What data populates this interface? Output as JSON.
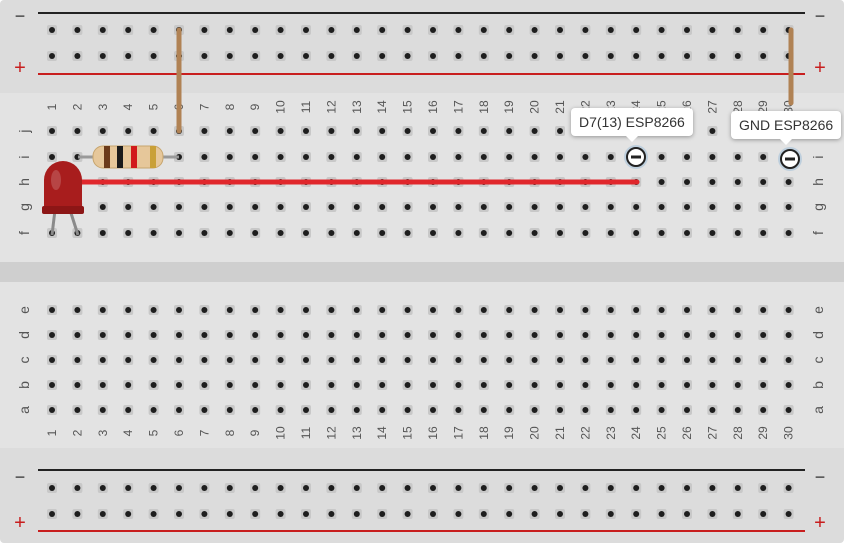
{
  "breadboard": {
    "column_numbers": [
      "1",
      "2",
      "3",
      "4",
      "5",
      "6",
      "7",
      "8",
      "9",
      "10",
      "11",
      "12",
      "13",
      "14",
      "15",
      "16",
      "17",
      "18",
      "19",
      "20",
      "21",
      "22",
      "23",
      "24",
      "25",
      "26",
      "27",
      "28",
      "29",
      "30"
    ],
    "top_row_letters": [
      "j",
      "i",
      "h",
      "g",
      "f"
    ],
    "bottom_row_letters": [
      "e",
      "d",
      "c",
      "b",
      "a"
    ],
    "rail_minus": "−",
    "rail_plus": "+",
    "colors": {
      "board": "#dcdcdc",
      "rail_line_red": "#c81e1e",
      "rail_line_black": "#222222",
      "hole": "#1e1e1e",
      "wire_red": "#e0272c",
      "wire_brown": "#b08254",
      "led": "#a81d1d"
    }
  },
  "components": {
    "led": {
      "name": "led",
      "color": "red"
    },
    "resistor": {
      "name": "resistor",
      "bands": [
        "#6b3a1a",
        "#1a1a1a",
        "#d11a1a",
        "#c9a037"
      ]
    },
    "pins": [
      {
        "label": "D7(13) ESP8266"
      },
      {
        "label": "GND ESP8266"
      }
    ]
  }
}
